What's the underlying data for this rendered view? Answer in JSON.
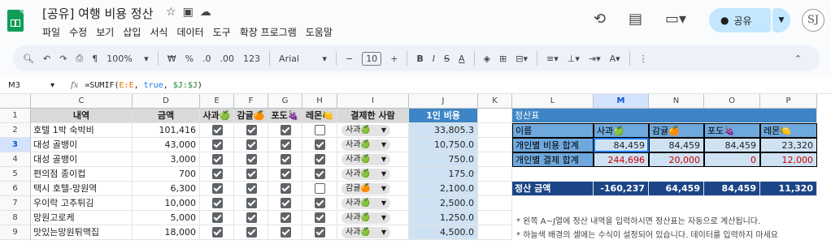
{
  "title": "[공유] 여행 비용 정산",
  "title_icons": [
    "star-icon",
    "folder-move-icon",
    "cloud-icon"
  ],
  "menu": [
    "파일",
    "수정",
    "보기",
    "삽입",
    "서식",
    "데이터",
    "도구",
    "확장 프로그램",
    "도움말"
  ],
  "share_label": "공유",
  "avatar_text": "SJ",
  "toolbar": {
    "zoom": "100%",
    "currency": "₩",
    "percent": "%",
    "dec_less": ".0",
    "dec_more": ".00",
    "format": "123",
    "font": "Arial",
    "font_size": "10",
    "bold": "B",
    "italic": "I",
    "strike": "S",
    "underline_a": "A"
  },
  "formula_bar": {
    "cell_ref": "M3",
    "fx": "fx",
    "formula_prefix": "=SUMIF(",
    "formula_r1": "E:E",
    "formula_mid1": ", ",
    "formula_true": "true",
    "formula_mid2": ", ",
    "formula_r2": "$J:$J",
    "formula_suffix": ")"
  },
  "columns": [
    "C",
    "D",
    "E",
    "F",
    "G",
    "H",
    "I",
    "J",
    "K",
    "L",
    "M",
    "N",
    "O",
    "P"
  ],
  "rows": [
    "1",
    "2",
    "3",
    "4",
    "5",
    "6",
    "7",
    "8",
    "9"
  ],
  "headers": {
    "item": "내역",
    "amount": "금액",
    "apple": "사과🍏",
    "tangerine": "감귤🍊",
    "grape": "포도🍇",
    "lemon": "레몬🍋",
    "payer": "결제한 사람",
    "per_person": "1인 비용"
  },
  "expenses": [
    {
      "item": "호텔 1박 숙박비",
      "amount": "101,416",
      "e": true,
      "f": true,
      "g": true,
      "h": false,
      "payer": "사과🍏",
      "per": "33,805.3"
    },
    {
      "item": "대성 골뱅이",
      "amount": "43,000",
      "e": true,
      "f": true,
      "g": true,
      "h": true,
      "payer": "사과🍏",
      "per": "10,750.0"
    },
    {
      "item": "대성 골뱅이",
      "amount": "3,000",
      "e": true,
      "f": true,
      "g": true,
      "h": true,
      "payer": "사과🍏",
      "per": "750.0"
    },
    {
      "item": "편의점 종이컵",
      "amount": "700",
      "e": true,
      "f": true,
      "g": true,
      "h": true,
      "payer": "사과🍏",
      "per": "175.0"
    },
    {
      "item": "택시 호텔-망원역",
      "amount": "6,300",
      "e": true,
      "f": true,
      "g": true,
      "h": false,
      "payer": "감귤🍊",
      "per": "2,100.0"
    },
    {
      "item": "우이락 고추튀김",
      "amount": "10,000",
      "e": true,
      "f": true,
      "g": true,
      "h": true,
      "payer": "사과🍏",
      "per": "2,500.0"
    },
    {
      "item": "망원고로케",
      "amount": "5,000",
      "e": true,
      "f": true,
      "g": true,
      "h": true,
      "payer": "사과🍏",
      "per": "1,250.0"
    },
    {
      "item": "맛있는망원튀맥집",
      "amount": "18,000",
      "e": true,
      "f": true,
      "g": true,
      "h": true,
      "payer": "사과🍏",
      "per": "4,500.0"
    }
  ],
  "settlement": {
    "title": "정산표",
    "name_label": "이름",
    "names": [
      "사과🍏",
      "감귤🍊",
      "포도🍇",
      "레몬🍋"
    ],
    "cost_label": "개인별 비용 합계",
    "cost": [
      "84,459",
      "84,459",
      "84,459",
      "23,320"
    ],
    "paid_label": "개인별 결제 합계",
    "paid": [
      "244,696",
      "20,000",
      "0",
      "12,000"
    ],
    "amount_label": "정산 금액",
    "amount": [
      "-160,237",
      "64,459",
      "84,459",
      "11,320"
    ]
  },
  "notes": [
    "* 왼쪽 A~J열에 정산 내역을 입력하시면 정산표는 자동으로 계산됩니다.",
    "* 하늘색 배경의 셀에는 수식이 설정되어 있습니다. 데이터를 입력하지 마세요"
  ]
}
